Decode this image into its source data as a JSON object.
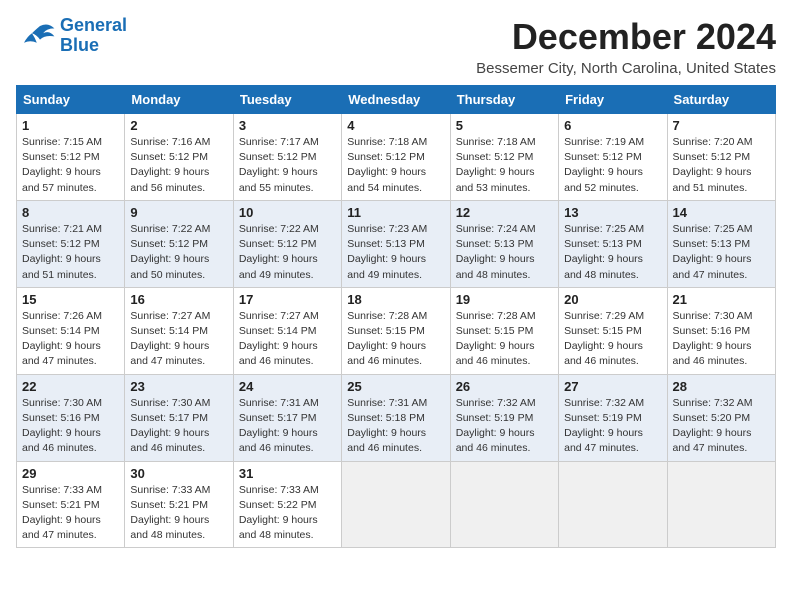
{
  "header": {
    "logo_line1": "General",
    "logo_line2": "Blue",
    "month": "December 2024",
    "location": "Bessemer City, North Carolina, United States"
  },
  "days_of_week": [
    "Sunday",
    "Monday",
    "Tuesday",
    "Wednesday",
    "Thursday",
    "Friday",
    "Saturday"
  ],
  "weeks": [
    [
      {
        "day": 1,
        "sunrise": "7:15 AM",
        "sunset": "5:12 PM",
        "daylight": "9 hours and 57 minutes."
      },
      {
        "day": 2,
        "sunrise": "7:16 AM",
        "sunset": "5:12 PM",
        "daylight": "9 hours and 56 minutes."
      },
      {
        "day": 3,
        "sunrise": "7:17 AM",
        "sunset": "5:12 PM",
        "daylight": "9 hours and 55 minutes."
      },
      {
        "day": 4,
        "sunrise": "7:18 AM",
        "sunset": "5:12 PM",
        "daylight": "9 hours and 54 minutes."
      },
      {
        "day": 5,
        "sunrise": "7:18 AM",
        "sunset": "5:12 PM",
        "daylight": "9 hours and 53 minutes."
      },
      {
        "day": 6,
        "sunrise": "7:19 AM",
        "sunset": "5:12 PM",
        "daylight": "9 hours and 52 minutes."
      },
      {
        "day": 7,
        "sunrise": "7:20 AM",
        "sunset": "5:12 PM",
        "daylight": "9 hours and 51 minutes."
      }
    ],
    [
      {
        "day": 8,
        "sunrise": "7:21 AM",
        "sunset": "5:12 PM",
        "daylight": "9 hours and 51 minutes."
      },
      {
        "day": 9,
        "sunrise": "7:22 AM",
        "sunset": "5:12 PM",
        "daylight": "9 hours and 50 minutes."
      },
      {
        "day": 10,
        "sunrise": "7:22 AM",
        "sunset": "5:12 PM",
        "daylight": "9 hours and 49 minutes."
      },
      {
        "day": 11,
        "sunrise": "7:23 AM",
        "sunset": "5:13 PM",
        "daylight": "9 hours and 49 minutes."
      },
      {
        "day": 12,
        "sunrise": "7:24 AM",
        "sunset": "5:13 PM",
        "daylight": "9 hours and 48 minutes."
      },
      {
        "day": 13,
        "sunrise": "7:25 AM",
        "sunset": "5:13 PM",
        "daylight": "9 hours and 48 minutes."
      },
      {
        "day": 14,
        "sunrise": "7:25 AM",
        "sunset": "5:13 PM",
        "daylight": "9 hours and 47 minutes."
      }
    ],
    [
      {
        "day": 15,
        "sunrise": "7:26 AM",
        "sunset": "5:14 PM",
        "daylight": "9 hours and 47 minutes."
      },
      {
        "day": 16,
        "sunrise": "7:27 AM",
        "sunset": "5:14 PM",
        "daylight": "9 hours and 47 minutes."
      },
      {
        "day": 17,
        "sunrise": "7:27 AM",
        "sunset": "5:14 PM",
        "daylight": "9 hours and 46 minutes."
      },
      {
        "day": 18,
        "sunrise": "7:28 AM",
        "sunset": "5:15 PM",
        "daylight": "9 hours and 46 minutes."
      },
      {
        "day": 19,
        "sunrise": "7:28 AM",
        "sunset": "5:15 PM",
        "daylight": "9 hours and 46 minutes."
      },
      {
        "day": 20,
        "sunrise": "7:29 AM",
        "sunset": "5:15 PM",
        "daylight": "9 hours and 46 minutes."
      },
      {
        "day": 21,
        "sunrise": "7:30 AM",
        "sunset": "5:16 PM",
        "daylight": "9 hours and 46 minutes."
      }
    ],
    [
      {
        "day": 22,
        "sunrise": "7:30 AM",
        "sunset": "5:16 PM",
        "daylight": "9 hours and 46 minutes."
      },
      {
        "day": 23,
        "sunrise": "7:30 AM",
        "sunset": "5:17 PM",
        "daylight": "9 hours and 46 minutes."
      },
      {
        "day": 24,
        "sunrise": "7:31 AM",
        "sunset": "5:17 PM",
        "daylight": "9 hours and 46 minutes."
      },
      {
        "day": 25,
        "sunrise": "7:31 AM",
        "sunset": "5:18 PM",
        "daylight": "9 hours and 46 minutes."
      },
      {
        "day": 26,
        "sunrise": "7:32 AM",
        "sunset": "5:19 PM",
        "daylight": "9 hours and 46 minutes."
      },
      {
        "day": 27,
        "sunrise": "7:32 AM",
        "sunset": "5:19 PM",
        "daylight": "9 hours and 47 minutes."
      },
      {
        "day": 28,
        "sunrise": "7:32 AM",
        "sunset": "5:20 PM",
        "daylight": "9 hours and 47 minutes."
      }
    ],
    [
      {
        "day": 29,
        "sunrise": "7:33 AM",
        "sunset": "5:21 PM",
        "daylight": "9 hours and 47 minutes."
      },
      {
        "day": 30,
        "sunrise": "7:33 AM",
        "sunset": "5:21 PM",
        "daylight": "9 hours and 48 minutes."
      },
      {
        "day": 31,
        "sunrise": "7:33 AM",
        "sunset": "5:22 PM",
        "daylight": "9 hours and 48 minutes."
      },
      null,
      null,
      null,
      null
    ]
  ]
}
